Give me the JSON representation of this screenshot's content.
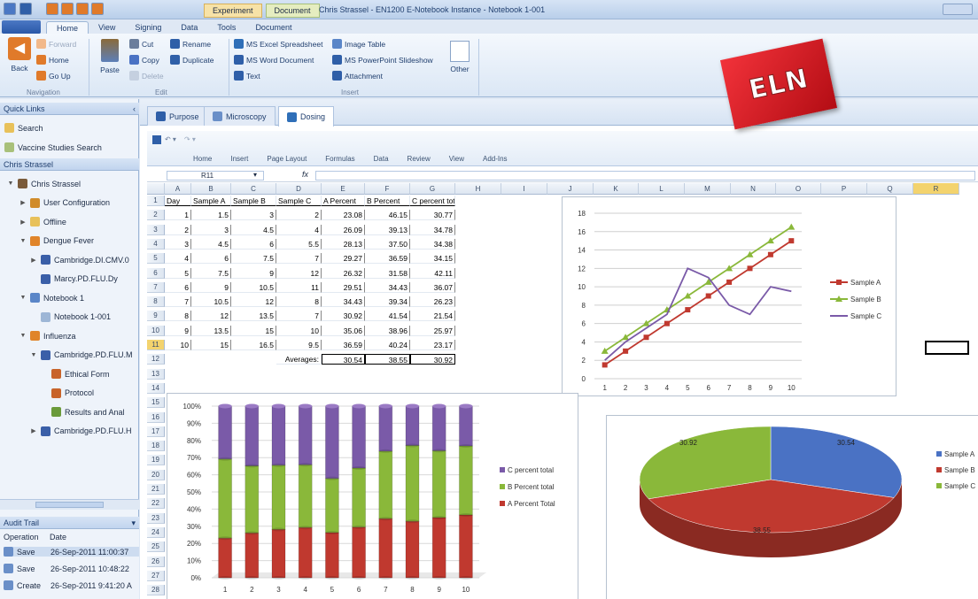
{
  "window": {
    "context_tabs": [
      "Experiment",
      "Document"
    ],
    "title": "Chris Strassel - EN1200 E-Notebook Instance - Notebook 1-001"
  },
  "ribbon": {
    "tabs": [
      "Home",
      "View",
      "Signing",
      "Data",
      "Tools",
      "Document"
    ],
    "active_tab": "Home",
    "navigation": {
      "back": "Back",
      "forward": "Forward",
      "home": "Home",
      "go_up": "Go Up",
      "group": "Navigation"
    },
    "edit": {
      "paste": "Paste",
      "cut": "Cut",
      "copy": "Copy",
      "delete": "Delete",
      "rename": "Rename",
      "duplicate": "Duplicate",
      "group": "Edit"
    },
    "insert": {
      "excel": "MS Excel Spreadsheet",
      "word": "MS Word Document",
      "text": "Text",
      "image_table": "Image Table",
      "powerpoint": "MS PowerPoint Slideshow",
      "attachment": "Attachment",
      "other": "Other",
      "group": "Insert"
    }
  },
  "quick_links": {
    "header": "Quick Links",
    "items": [
      "Search",
      "Vaccine Studies Search"
    ]
  },
  "tree": {
    "header": "Chris Strassel",
    "items": [
      {
        "label": "Chris Strassel",
        "toggle": "▼",
        "icon": "user-icon",
        "color": "#7a5b3a"
      },
      {
        "label": "User Configuration",
        "toggle": "▶",
        "icon": "wrench-icon",
        "color": "#d08b2a"
      },
      {
        "label": "Offline",
        "toggle": "▶",
        "icon": "folder-icon",
        "color": "#e8c15a"
      },
      {
        "label": "Dengue Fever",
        "toggle": "▼",
        "icon": "book-icon",
        "color": "#e0842a"
      },
      {
        "label": "Cambridge.DI.CMV.0",
        "toggle": "▶",
        "icon": "flask-icon",
        "color": "#3a5fa8"
      },
      {
        "label": "Marcy.PD.FLU.Dy",
        "toggle": "",
        "icon": "flask-icon",
        "color": "#3a5fa8"
      },
      {
        "label": "Notebook 1",
        "toggle": "▼",
        "icon": "notebook-icon",
        "color": "#5a86c8"
      },
      {
        "label": "Notebook 1-001",
        "toggle": "",
        "icon": "page-icon",
        "color": "#9db6d6"
      },
      {
        "label": "Influenza",
        "toggle": "▼",
        "icon": "book-icon",
        "color": "#e0842a"
      },
      {
        "label": "Cambridge.PD.FLU.M",
        "toggle": "▼",
        "icon": "flask-icon",
        "color": "#3a5fa8"
      },
      {
        "label": "Ethical Form",
        "toggle": "",
        "icon": "doc-icon",
        "color": "#c8642a"
      },
      {
        "label": "Protocol",
        "toggle": "",
        "icon": "doc-icon",
        "color": "#c8642a"
      },
      {
        "label": "Results and Anal",
        "toggle": "",
        "icon": "chart-icon",
        "color": "#6a9a3a"
      },
      {
        "label": "Cambridge.PD.FLU.H",
        "toggle": "▶",
        "icon": "flask-icon",
        "color": "#3a5fa8"
      }
    ]
  },
  "audit": {
    "header": "Audit Trail",
    "columns": [
      "Operation",
      "Date"
    ],
    "rows": [
      {
        "op": "Save",
        "date": "26-Sep-2011 11:00:37"
      },
      {
        "op": "Save",
        "date": "26-Sep-2011 10:48:22"
      },
      {
        "op": "Create",
        "date": "26-Sep-2011 9:41:20 A"
      }
    ]
  },
  "doc_tabs": [
    {
      "label": "Purpose",
      "icon": "book-icon"
    },
    {
      "label": "Microscopy",
      "icon": "table-icon"
    },
    {
      "label": "Dosing",
      "icon": "excel-icon"
    }
  ],
  "active_doc_tab": "Dosing",
  "excel": {
    "menu": [
      "Home",
      "Insert",
      "Page Layout",
      "Formulas",
      "Data",
      "Review",
      "View",
      "Add-Ins"
    ],
    "name_box": "R11",
    "fx": "fx",
    "columns": [
      "A",
      "B",
      "C",
      "D",
      "E",
      "F",
      "G",
      "H",
      "I",
      "J",
      "K",
      "L",
      "M",
      "N",
      "O",
      "P",
      "Q",
      "R"
    ],
    "rows": [
      "1",
      "2",
      "3",
      "4",
      "5",
      "6",
      "7",
      "8",
      "9",
      "10",
      "11",
      "12",
      "13",
      "14",
      "15",
      "16",
      "17",
      "18",
      "19",
      "20",
      "21",
      "22",
      "23",
      "24",
      "25",
      "26",
      "27",
      "28"
    ],
    "headers": [
      "Day",
      "Sample A",
      "Sample B",
      "Sample C",
      "A Percent",
      "B Percent",
      "C percent total"
    ],
    "data": [
      [
        "1",
        "1.5",
        "3",
        "2",
        "23.08",
        "46.15",
        "30.77"
      ],
      [
        "2",
        "3",
        "4.5",
        "4",
        "26.09",
        "39.13",
        "34.78"
      ],
      [
        "3",
        "4.5",
        "6",
        "5.5",
        "28.13",
        "37.50",
        "34.38"
      ],
      [
        "4",
        "6",
        "7.5",
        "7",
        "29.27",
        "36.59",
        "34.15"
      ],
      [
        "5",
        "7.5",
        "9",
        "12",
        "26.32",
        "31.58",
        "42.11"
      ],
      [
        "6",
        "9",
        "10.5",
        "11",
        "29.51",
        "34.43",
        "36.07"
      ],
      [
        "7",
        "10.5",
        "12",
        "8",
        "34.43",
        "39.34",
        "26.23"
      ],
      [
        "8",
        "12",
        "13.5",
        "7",
        "30.92",
        "41.54",
        "21.54"
      ],
      [
        "9",
        "13.5",
        "15",
        "10",
        "35.06",
        "38.96",
        "25.97"
      ],
      [
        "10",
        "15",
        "16.5",
        "9.5",
        "36.59",
        "40.24",
        "23.17"
      ]
    ],
    "averages_label": "Averages:",
    "averages": [
      "30.54",
      "38.55",
      "30.92"
    ]
  },
  "colors": {
    "red": "#c0392f",
    "green": "#8ab83a",
    "purple": "#7a5aa8",
    "blue": "#4a72c4",
    "accent": "#2a58a8"
  },
  "badge": "ELN",
  "chart_data": [
    {
      "type": "line",
      "x": [
        1,
        2,
        3,
        4,
        5,
        6,
        7,
        8,
        9,
        10
      ],
      "series": [
        {
          "name": "Sample A",
          "values": [
            1.5,
            3,
            4.5,
            6,
            7.5,
            9,
            10.5,
            12,
            13.5,
            15
          ]
        },
        {
          "name": "Sample B",
          "values": [
            3,
            4.5,
            6,
            7.5,
            9,
            10.5,
            12,
            13.5,
            15,
            16.5
          ]
        },
        {
          "name": "Sample C",
          "values": [
            2,
            4,
            5.5,
            7,
            12,
            11,
            8,
            7,
            10,
            9.5
          ]
        }
      ],
      "ylim": [
        0,
        18
      ],
      "yticks": [
        "0",
        "2",
        "4",
        "6",
        "8",
        "10",
        "12",
        "14",
        "16",
        "18"
      ],
      "legend": "right",
      "grid": true
    },
    {
      "type": "bar",
      "stacked": "percent",
      "categories": [
        "1",
        "2",
        "3",
        "4",
        "5",
        "6",
        "7",
        "8",
        "9",
        "10"
      ],
      "series": [
        {
          "name": "A Percent Total",
          "values": [
            23.08,
            26.09,
            28.13,
            29.27,
            26.32,
            29.51,
            34.43,
            30.92,
            35.06,
            36.59
          ]
        },
        {
          "name": "B Percent total",
          "values": [
            46.15,
            39.13,
            37.5,
            36.59,
            31.58,
            34.43,
            39.34,
            41.54,
            38.96,
            40.24
          ]
        },
        {
          "name": "C percent total",
          "values": [
            30.77,
            34.78,
            34.38,
            34.15,
            42.11,
            36.07,
            26.23,
            21.54,
            25.97,
            23.17
          ]
        }
      ],
      "yticks": [
        "0%",
        "10%",
        "20%",
        "30%",
        "40%",
        "50%",
        "60%",
        "70%",
        "80%",
        "90%",
        "100%"
      ],
      "legend": "right"
    },
    {
      "type": "pie",
      "slices": [
        {
          "label": "30.54",
          "value": 30.54
        },
        {
          "label": "38.55",
          "value": 38.55
        },
        {
          "label": "30.92",
          "value": 30.92
        }
      ],
      "legend_entries": [
        "Sample A",
        "Sample B",
        "Sample C"
      ],
      "legend": "right"
    }
  ]
}
